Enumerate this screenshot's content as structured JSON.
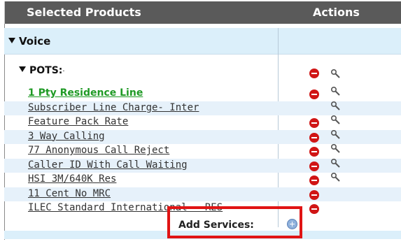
{
  "header": {
    "products_title": "Selected Products",
    "actions_title": "Actions"
  },
  "group": {
    "label": "Voice"
  },
  "subgroup": {
    "label": "POTS:",
    "suffix": "·"
  },
  "items": [
    {
      "label": "1 Pty Residence Line",
      "remove": true,
      "edit": true
    },
    {
      "label": "Subscriber Line Charge- Inter",
      "remove": false,
      "edit": true
    },
    {
      "label": "Feature Pack Rate",
      "remove": true,
      "edit": true
    },
    {
      "label": "3 Way Calling",
      "remove": true,
      "edit": true
    },
    {
      "label": "77 Anonymous Call Reject",
      "remove": true,
      "edit": true
    },
    {
      "label": "Caller ID With Call Waiting",
      "remove": true,
      "edit": true
    },
    {
      "label": "HSI 3M/640K Res",
      "remove": true,
      "edit": true
    },
    {
      "label": "11 Cent No MRC",
      "remove": true,
      "edit": false
    },
    {
      "label": "ILEC Standard International - RES",
      "remove": true,
      "edit": false
    }
  ],
  "add_services": {
    "label": "Add Services:"
  },
  "colors": {
    "header_bg": "#5a5a5a",
    "highlight_border": "#e01414",
    "primary_item": "#1f9a25",
    "remove_icon": "#d01515"
  }
}
